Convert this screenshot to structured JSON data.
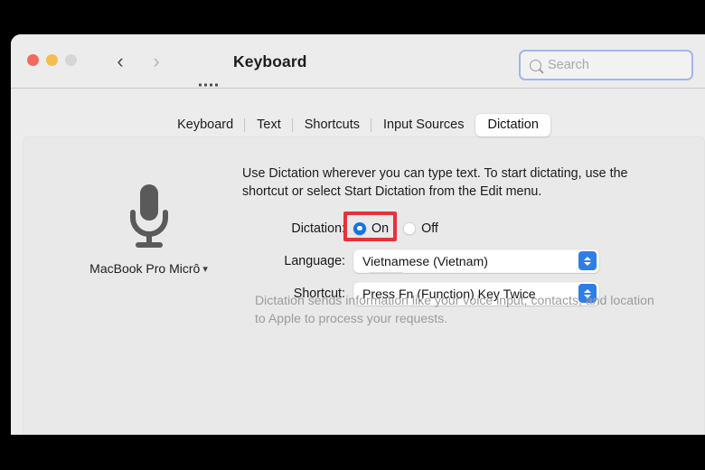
{
  "window": {
    "title": "Keyboard",
    "traffic_lights": [
      "close-red",
      "minimize-yellow",
      "zoom-grey"
    ],
    "nav_back": "‹",
    "nav_forward": "›",
    "grid_icon": "show-all-icon"
  },
  "search": {
    "placeholder": "Search",
    "value": "",
    "icon": "search-icon",
    "focus_ring_color": "#a4b4ea"
  },
  "tabs": [
    {
      "label": "Keyboard",
      "active": false
    },
    {
      "label": "Text",
      "active": false
    },
    {
      "label": "Shortcuts",
      "active": false
    },
    {
      "label": "Input Sources",
      "active": false
    },
    {
      "label": "Dictation",
      "active": true
    }
  ],
  "microphone": {
    "icon": "microphone-icon",
    "label": "MacBook Pro Micrô",
    "chevron": "⌄"
  },
  "description": "Use Dictation wherever you can type text. To start dictating, use the shortcut or select Start Dictation from the Edit menu.",
  "form": {
    "dictation": {
      "label": "Dictation:",
      "options": [
        {
          "label": "On",
          "selected": true
        },
        {
          "label": "Off",
          "selected": false
        }
      ],
      "highlight": true,
      "highlight_color": "#e8313a",
      "accent_color": "#1474e5"
    },
    "language": {
      "label": "Language:",
      "value": "Vietnamese (Vietnam)",
      "stepper_color": "#2e7ee8"
    },
    "shortcut": {
      "label": "Shortcut:",
      "value": "Press Fn (Function) Key Twice",
      "stepper_color": "#2e7ee8"
    }
  },
  "footnote": "Dictation sends information like your voice input, contacts, and location to Apple to process your requests."
}
